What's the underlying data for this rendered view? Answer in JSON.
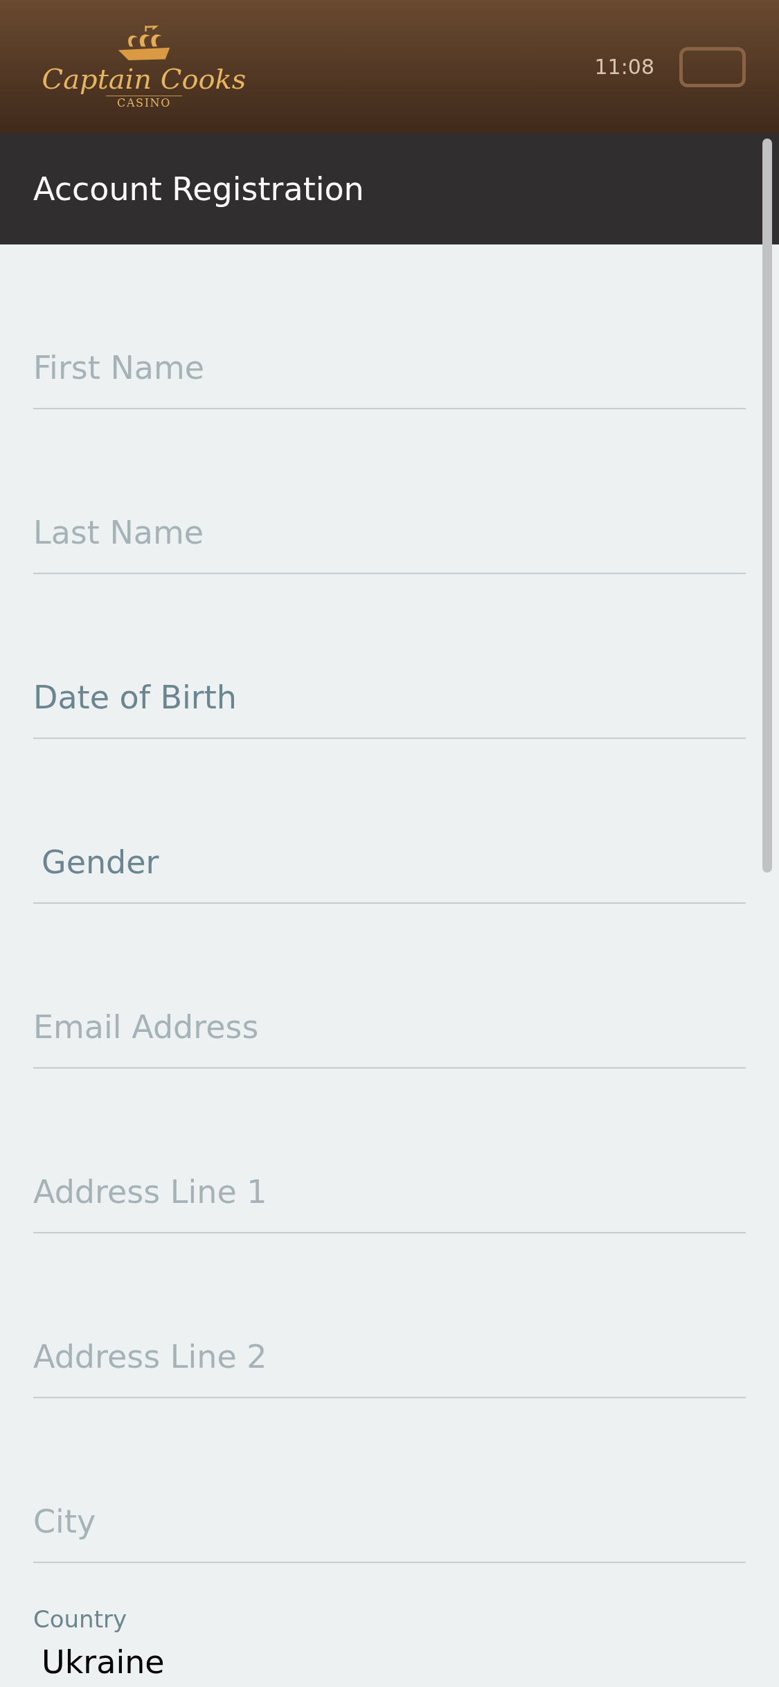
{
  "header": {
    "logo": {
      "name": "Captain Cooks",
      "sub": "CASINO"
    },
    "time": "11:08"
  },
  "title": "Account Registration",
  "fields": [
    {
      "kind": "input",
      "placeholder": "First Name"
    },
    {
      "kind": "input",
      "placeholder": "Last Name"
    },
    {
      "kind": "select",
      "label": "Date of Birth",
      "indent": false
    },
    {
      "kind": "select",
      "label": "Gender",
      "indent": true
    },
    {
      "kind": "input",
      "placeholder": "Email Address"
    },
    {
      "kind": "input",
      "placeholder": "Address Line 1"
    },
    {
      "kind": "input",
      "placeholder": "Address Line 2"
    },
    {
      "kind": "input",
      "placeholder": "City"
    }
  ],
  "country": {
    "label": "Country",
    "value": "Ukraine"
  }
}
